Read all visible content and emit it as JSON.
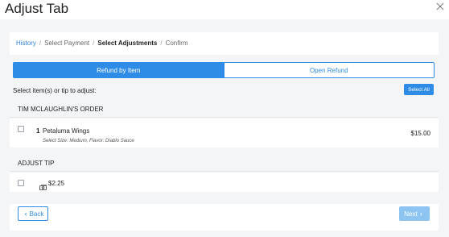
{
  "modal": {
    "title": "Adjust Tab"
  },
  "breadcrumb": {
    "history": "History",
    "select_payment": "Select Payment",
    "select_adjustments": "Select Adjustments",
    "confirm": "Confirm",
    "separator": "/"
  },
  "tabs": {
    "refund_by_item": "Refund by Item",
    "open_refund": "Open Refund",
    "active": "refund_by_item"
  },
  "selection": {
    "label": "Select item(s) or tip to adjust:",
    "select_all": "Select All"
  },
  "order": {
    "header": "TIM MCLAUGHLIN'S ORDER",
    "items": [
      {
        "qty": "1",
        "name": "Petaluma Wings",
        "modifiers": "Select Size: Medium, Flavor: Diablo Sauce",
        "price": "$15.00",
        "checked": false
      }
    ]
  },
  "tip": {
    "header": "ADJUST TIP",
    "amount": "$2.25",
    "icon": "cash-icon",
    "checked": false
  },
  "footer": {
    "back": "Back",
    "next": "Next"
  },
  "colors": {
    "primary": "#2f8ce6",
    "primary_disabled": "#8ec4f2",
    "link": "#2d7fd3",
    "background": "#f4f5f7"
  }
}
